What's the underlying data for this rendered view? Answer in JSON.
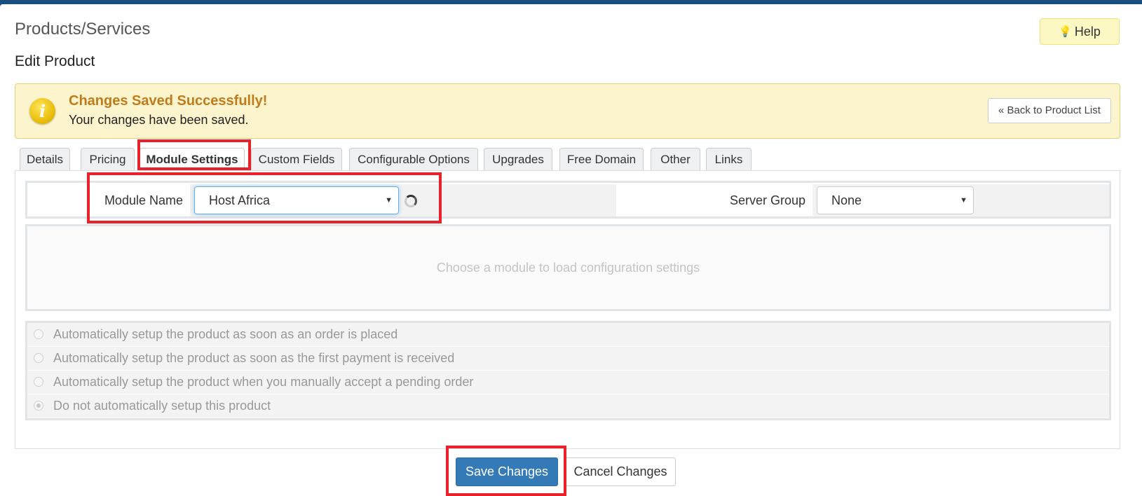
{
  "header": {
    "title": "Products/Services",
    "help_label": "Help",
    "help_icon": "lightbulb-icon",
    "subtitle": "Edit Product"
  },
  "alert": {
    "icon": "info-icon",
    "icon_glyph": "i",
    "title": "Changes Saved Successfully!",
    "message": "Your changes have been saved.",
    "back_label": "« Back to Product List"
  },
  "tabs": [
    {
      "label": "Details",
      "active": false
    },
    {
      "label": "Pricing",
      "active": false
    },
    {
      "label": "Module Settings",
      "active": true
    },
    {
      "label": "Custom Fields",
      "active": false
    },
    {
      "label": "Configurable Options",
      "active": false
    },
    {
      "label": "Upgrades",
      "active": false
    },
    {
      "label": "Free Domain",
      "active": false
    },
    {
      "label": "Other",
      "active": false
    },
    {
      "label": "Links",
      "active": false
    }
  ],
  "module_settings": {
    "module_name_label": "Module Name",
    "module_name_value": "Host Africa",
    "server_group_label": "Server Group",
    "server_group_value": "None",
    "placeholder_text": "Choose a module to load configuration settings"
  },
  "setup_options": [
    {
      "label": "Automatically setup the product as soon as an order is placed",
      "checked": false
    },
    {
      "label": "Automatically setup the product as soon as the first payment is received",
      "checked": false
    },
    {
      "label": "Automatically setup the product when you manually accept a pending order",
      "checked": false
    },
    {
      "label": "Do not automatically setup this product",
      "checked": true
    }
  ],
  "actions": {
    "save_label": "Save Changes",
    "cancel_label": "Cancel Changes"
  },
  "colors": {
    "primary": "#337ab7",
    "alert_bg": "#fcf4cc",
    "alert_title": "#c07c1c",
    "annotation_red": "#e8212a"
  }
}
